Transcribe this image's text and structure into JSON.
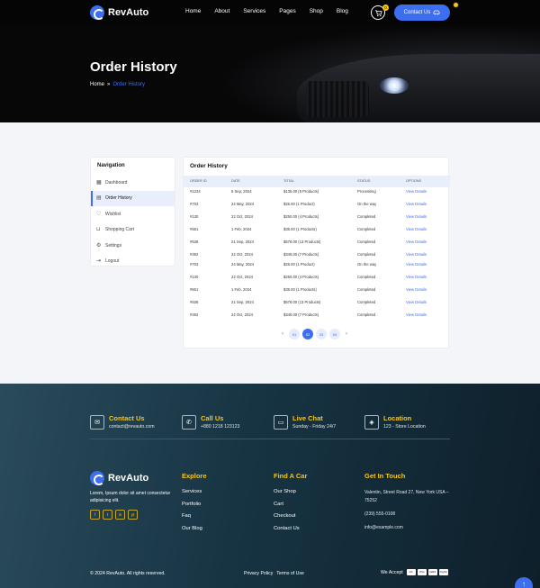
{
  "brand": {
    "name": "RevAuto",
    "accent": "#3d6ef0",
    "yellow": "#f5c518"
  },
  "nav": {
    "items": [
      "Home",
      "About",
      "Services",
      "Pages",
      "Shop",
      "Blog"
    ],
    "cart_count": "0",
    "contact_label": "Contact Us"
  },
  "hero": {
    "title": "Order History",
    "breadcrumb_home": "Home",
    "breadcrumb_current": "Order History"
  },
  "sidebar": {
    "title": "Navigation",
    "items": [
      {
        "label": "Dashboard",
        "icon": "grid-icon"
      },
      {
        "label": "Order History",
        "icon": "document-icon"
      },
      {
        "label": "Wishlist",
        "icon": "heart-icon"
      },
      {
        "label": "Shopping Cart",
        "icon": "bag-icon"
      },
      {
        "label": "Settings",
        "icon": "gear-icon"
      },
      {
        "label": "Logout",
        "icon": "logout-icon"
      }
    ]
  },
  "orders": {
    "title": "Order History",
    "columns": [
      "ORDER ID",
      "DATE",
      "TOTAL",
      "STATUS",
      "OPTIONS"
    ],
    "rows": [
      {
        "id": "#1234",
        "date": "8 Sep, 2024",
        "total": "$135.00 (5 Products)",
        "status": "Processing",
        "option": "View Details"
      },
      {
        "id": "#703",
        "date": "24 May, 2024",
        "total": "$25.00 (1 Product)",
        "status": "On the way",
        "option": "View Details"
      },
      {
        "id": "#130",
        "date": "22 Oct, 2024",
        "total": "$250.00 (4 Products)",
        "status": "Completed",
        "option": "View Details"
      },
      {
        "id": "#561",
        "date": "1 Feb, 2024",
        "total": "$35.00 (1 Products)",
        "status": "Completed",
        "option": "View Details"
      },
      {
        "id": "#536",
        "date": "21 Sep, 2024",
        "total": "$578.00 (13 Products)",
        "status": "Completed",
        "option": "View Details"
      },
      {
        "id": "#492",
        "date": "22 Oct, 2024",
        "total": "$345.00 (7 Products)",
        "status": "Completed",
        "option": "View Details"
      },
      {
        "id": "#703",
        "date": "24 May, 2024",
        "total": "$25.00 (1 Product)",
        "status": "On the way",
        "option": "View Details"
      },
      {
        "id": "#130",
        "date": "22 Oct, 2024",
        "total": "$250.00 (4 Products)",
        "status": "Completed",
        "option": "View Details"
      },
      {
        "id": "#561",
        "date": "1 Feb, 2024",
        "total": "$35.00 (1 Products)",
        "status": "Completed",
        "option": "View Details"
      },
      {
        "id": "#536",
        "date": "21 Sep, 2024",
        "total": "$578.00 (13 Products)",
        "status": "Completed",
        "option": "View Details"
      },
      {
        "id": "#492",
        "date": "22 Oct, 2024",
        "total": "$345.00 (7 Products)",
        "status": "Completed",
        "option": "View Details"
      }
    ],
    "pages": [
      "01",
      "02",
      "03",
      "04"
    ],
    "current_page": "02"
  },
  "footer": {
    "contacts": [
      {
        "title": "Contact Us",
        "sub": "contact@revauto.com",
        "icon": "mail-icon"
      },
      {
        "title": "Call Us",
        "sub": "+880 1218 123123",
        "icon": "phone-icon"
      },
      {
        "title": "Live Chat",
        "sub": "Sunday - Friday 24/7",
        "icon": "chat-icon"
      },
      {
        "title": "Location",
        "sub": "123 - Store Location",
        "icon": "location-icon"
      }
    ],
    "desc": "Lorem, Ipsum dolor sit amet consectetur adipisicing elit.",
    "socials": [
      "f",
      "t",
      "in",
      "yt"
    ],
    "explore": {
      "title": "Explore",
      "links": [
        "Services",
        "Portfolio",
        "Faq",
        "Our Blog"
      ]
    },
    "find": {
      "title": "Find A Car",
      "links": [
        "Our Shop",
        "Cart",
        "Checkout",
        "Contact Us"
      ]
    },
    "touch": {
      "title": "Get In Touch",
      "address": "Valentin, Street Road 27, New York USA – 75252",
      "phone": "(239) 555-0108",
      "email": "info@example.com"
    },
    "copyright": "© 2024 RevAuto. All rights reserved.",
    "privacy": "Privacy Policy",
    "terms": "Terms of Use",
    "accept": "We Accept",
    "cards": [
      "MC",
      "VISA",
      "AMEX",
      "PayPal"
    ]
  }
}
